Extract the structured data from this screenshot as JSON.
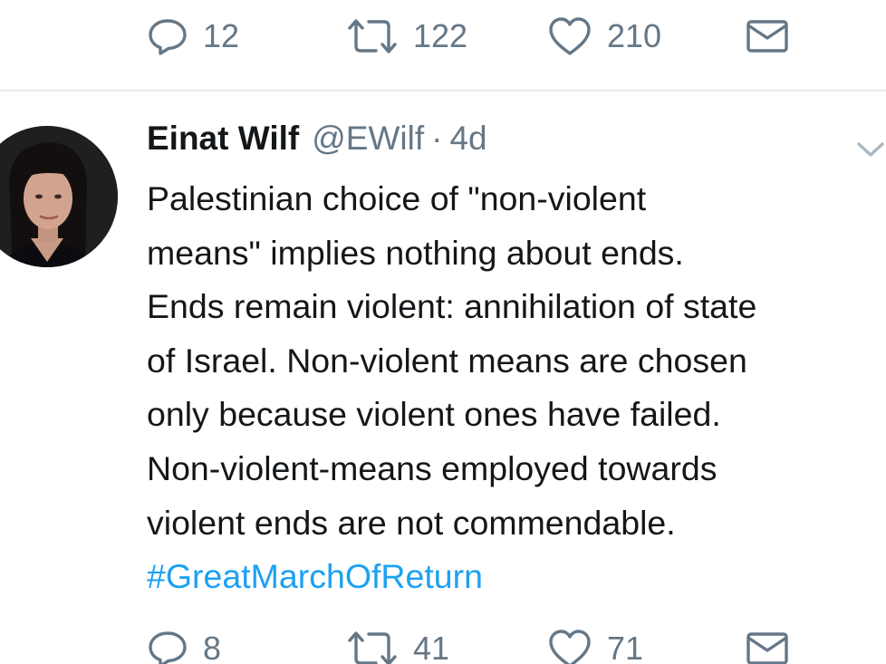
{
  "prev_tweet": {
    "actions": {
      "reply_count": "12",
      "retweet_count": "122",
      "like_count": "210"
    }
  },
  "tweet": {
    "author_name": "Einat Wilf",
    "author_handle": "@EWilf",
    "separator": "·",
    "timestamp": "4d",
    "text_lines": [
      "Palestinian choice of \"non-violent",
      "means\" implies nothing about ends.",
      "Ends remain violent: annihilation of state",
      "of Israel. Non-violent means are chosen",
      "only because violent ones have failed.",
      "Non-violent-means employed towards",
      "violent ends are not commendable."
    ],
    "hashtag": "#GreatMarchOfReturn",
    "actions": {
      "reply_count": "8",
      "retweet_count": "41",
      "like_count": "71"
    }
  },
  "colors": {
    "text": "#14171a",
    "secondary": "#657786",
    "link": "#1da1f2",
    "divider": "#e6ecf0"
  },
  "icons": [
    "reply-icon",
    "retweet-icon",
    "like-icon",
    "direct-message-icon",
    "chevron-down-icon"
  ]
}
